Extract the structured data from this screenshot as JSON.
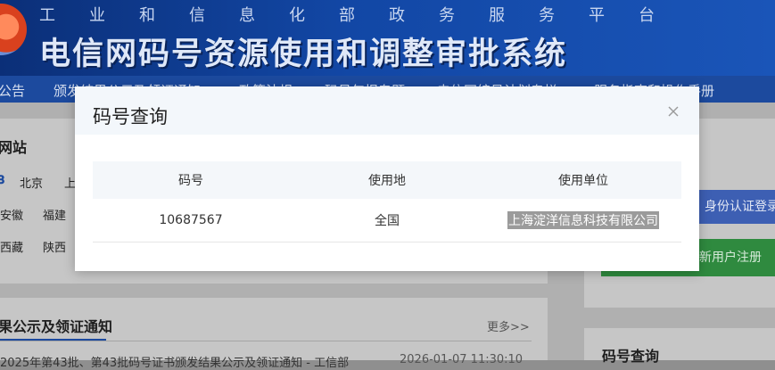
{
  "banner": {
    "subtitle": "工业和信息化部政务服务平台",
    "title": "电信网码号资源使用和调整审批系统"
  },
  "nav": {
    "items": [
      "公告",
      "颁发结果公示及领证通知",
      "政策法规",
      "码号年报专题",
      "电信网编号计划专栏",
      "服务指南和操作手册"
    ]
  },
  "left_panel": {
    "title": "网站",
    "cities_row1": [
      "北京",
      "上"
    ],
    "cities_row2": [
      "安徽",
      "福建"
    ],
    "cities_row3": [
      "西藏",
      "陕西"
    ]
  },
  "right_panel": {
    "login_button": "身份认证登录",
    "register_button": "新用户注册",
    "query_title": "码号查询"
  },
  "news": {
    "title": "果公示及领证通知",
    "more": "更多>>",
    "item_text": "2025年第43批、第43批码号证书颁发结果公示及领证通知 - 工信部",
    "item_date": "2026-01-07 11:30:10"
  },
  "modal": {
    "title": "码号查询",
    "close_label": "×",
    "columns": [
      "码号",
      "使用地",
      "使用单位"
    ],
    "rows": [
      {
        "number": "10687567",
        "location": "全国",
        "unit": "上海淀洋信息科技有限公司"
      }
    ]
  },
  "colors": {
    "banner": "#1247a5",
    "overlay": "#8f8f8f",
    "modal_header": "#f3f7fb",
    "highlight": "#9b9b9b"
  }
}
